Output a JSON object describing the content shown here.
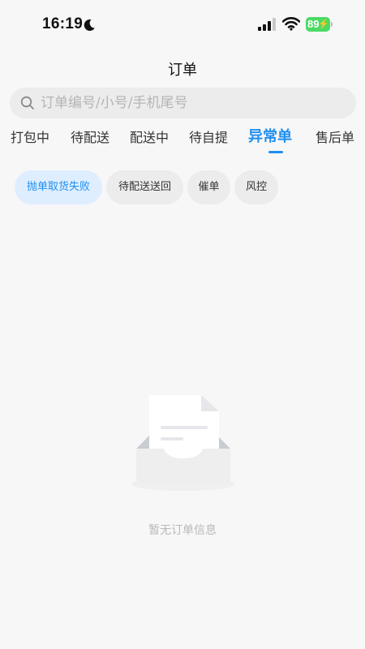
{
  "status_bar": {
    "time": "16:19",
    "battery": "89"
  },
  "header": {
    "title": "订单"
  },
  "search": {
    "placeholder": "订单编号/小号/手机尾号",
    "value": ""
  },
  "tabs": [
    {
      "label": "打包中"
    },
    {
      "label": "待配送"
    },
    {
      "label": "配送中"
    },
    {
      "label": "待自提"
    },
    {
      "label": "异常单",
      "active": true
    },
    {
      "label": "售后单"
    }
  ],
  "filter_chips": [
    {
      "label": "抛单取货失败",
      "active": true
    },
    {
      "label": "待配送送回"
    },
    {
      "label": "催单"
    },
    {
      "label": "风控"
    }
  ],
  "empty_state": {
    "message": "暂无订单信息",
    "icon": "empty-inbox-icon"
  },
  "colors": {
    "accent": "#1f8ff0",
    "chip_active_bg": "#dfeeff",
    "battery": "#4cd964"
  }
}
